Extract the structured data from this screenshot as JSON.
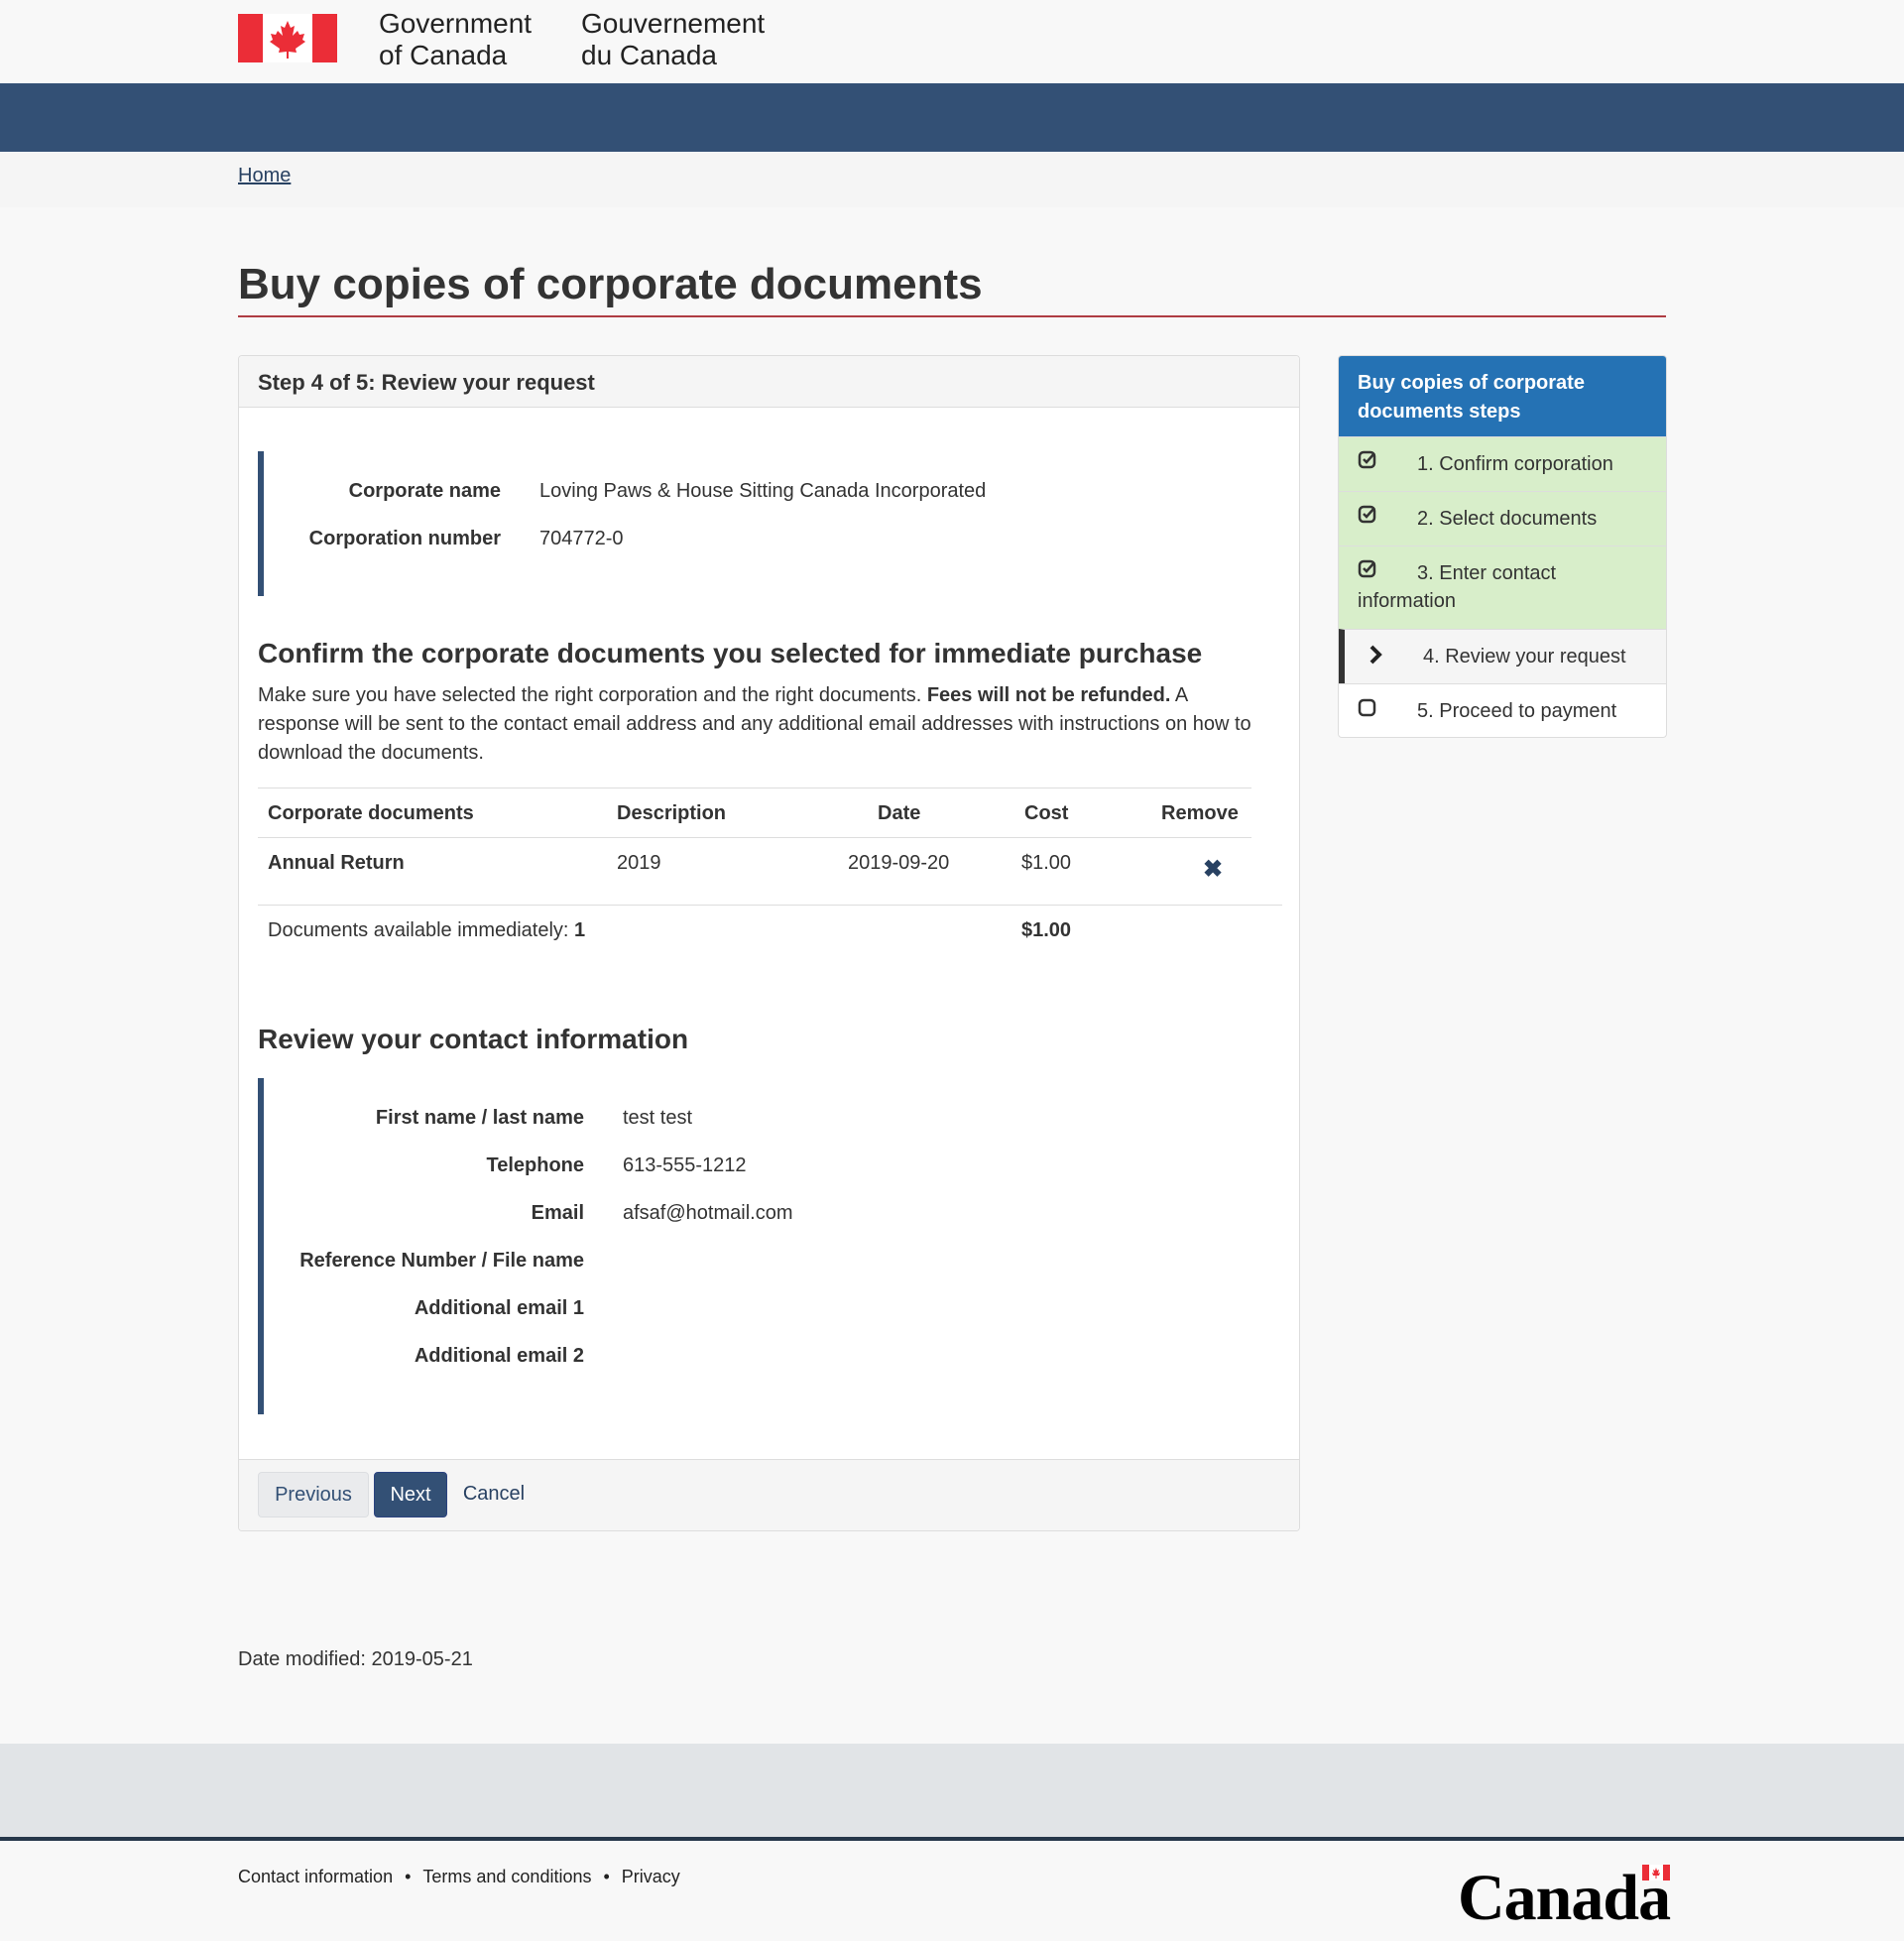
{
  "header": {
    "sig_en_line1": "Government",
    "sig_en_line2": "of Canada",
    "sig_fr_line1": "Gouvernement",
    "sig_fr_line2": "du Canada"
  },
  "breadcrumb": {
    "home": "Home"
  },
  "page_title": "Buy copies of corporate documents",
  "panel": {
    "heading": "Step 4 of 5: Review your request",
    "corporation": {
      "name_label": "Corporate name",
      "name_value": "Loving Paws & House Sitting Canada Incorporated",
      "number_label": "Corporation number",
      "number_value": "704772-0"
    },
    "confirm_heading": "Confirm the corporate documents you selected for immediate purchase",
    "confirm_text_1": "Make sure you have selected the right corporation and the right documents.",
    "confirm_text_bold": "Fees will not be refunded.",
    "confirm_text_2": "A response will be sent to the contact email address and any additional email addresses with instructions on how to download the documents.",
    "table": {
      "headers": [
        "Corporate documents",
        "Description",
        "Date",
        "Cost",
        "Remove"
      ],
      "rows": [
        {
          "document": "Annual Return",
          "description": "2019",
          "date": "2019-09-20",
          "cost": "$1.00",
          "remove": "✖"
        }
      ],
      "total_label": "Documents available immediately:",
      "total_count": "1",
      "total_cost": "$1.00"
    },
    "contact_heading": "Review your contact information",
    "contact": {
      "name_label": "First name / last name",
      "name_value": "test test",
      "phone_label": "Telephone",
      "phone_value": "613-555-1212",
      "email_label": "Email",
      "email_value": "afsaf@hotmail.com",
      "ref_label": "Reference Number / File name",
      "add1_label": "Additional email 1",
      "add2_label": "Additional email 2"
    },
    "buttons": {
      "previous": "Previous",
      "next": "Next",
      "cancel": "Cancel"
    }
  },
  "sidebar": {
    "title": "Buy copies of corporate documents steps",
    "steps": [
      {
        "label": "1. Confirm corporation",
        "state": "done"
      },
      {
        "label": "2. Select documents",
        "state": "done"
      },
      {
        "label_1": "3. Enter contact",
        "label_2": "information",
        "state": "done"
      },
      {
        "label": "4. Review your request",
        "state": "current"
      },
      {
        "label": "5. Proceed to payment",
        "state": "todo"
      }
    ]
  },
  "date_modified": "Date modified: 2019-05-21",
  "footer": {
    "links": [
      "Contact information",
      "Terms and conditions",
      "Privacy"
    ],
    "wordmark": "Canada"
  },
  "colors": {
    "nav": "#335075",
    "accent_red": "#af3c43",
    "sidebar_head": "#2572b4",
    "done_bg": "#d8eeca"
  }
}
